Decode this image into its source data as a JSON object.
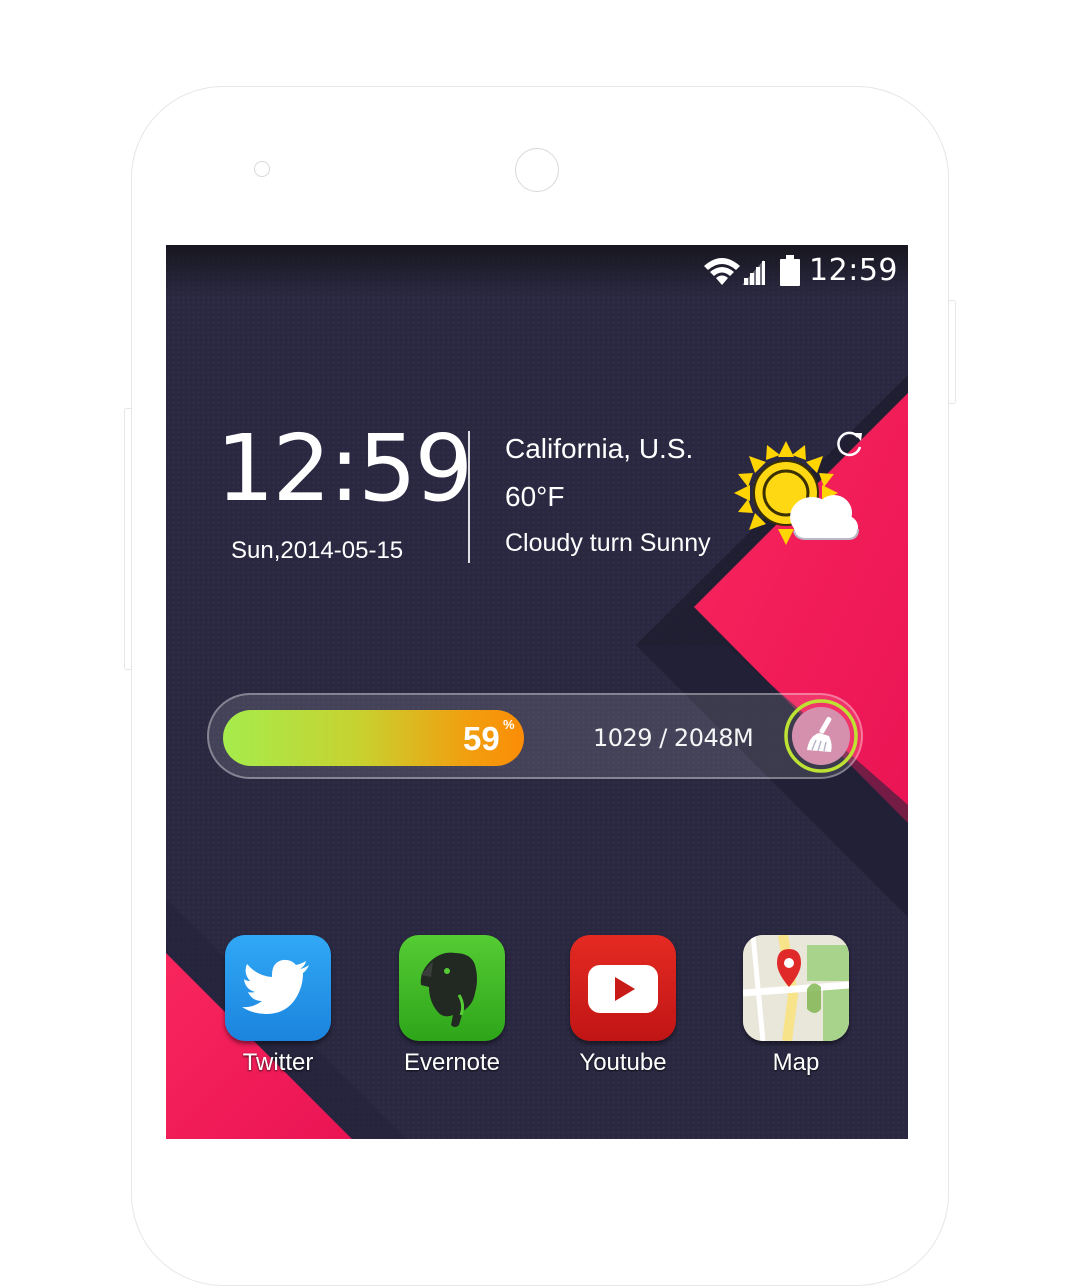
{
  "status_bar": {
    "time": "12:59",
    "icons": [
      "wifi-icon",
      "signal-icon",
      "battery-icon"
    ]
  },
  "clock_widget": {
    "time": "12:59",
    "date": "Sun,2014-05-15"
  },
  "weather_widget": {
    "location": "California, U.S.",
    "temperature": "60°F",
    "condition": "Cloudy turn Sunny",
    "icon": "sun-cloud-icon",
    "refresh_icon": "refresh-icon"
  },
  "memory_widget": {
    "percent_value": "59",
    "percent_sign": "%",
    "usage": "1029 / 2048M",
    "used_fraction": 0.59,
    "boost_icon": "broom-icon",
    "fill_start_color": "#a5ec4c",
    "fill_end_color": "#fb8d06"
  },
  "dock": {
    "apps": [
      {
        "label": "Twitter",
        "icon": "twitter-icon",
        "color": "#1d8fe6"
      },
      {
        "label": "Evernote",
        "icon": "evernote-icon",
        "color": "#3db524"
      },
      {
        "label": "Youtube",
        "icon": "youtube-icon",
        "color": "#d0201c"
      },
      {
        "label": "Map",
        "icon": "map-icon",
        "color": "#e6e4dc"
      }
    ]
  },
  "colors": {
    "wallpaper_dark": "#2a2841",
    "wallpaper_accent": "#f0185a",
    "phone_frame": "#ffffff"
  }
}
